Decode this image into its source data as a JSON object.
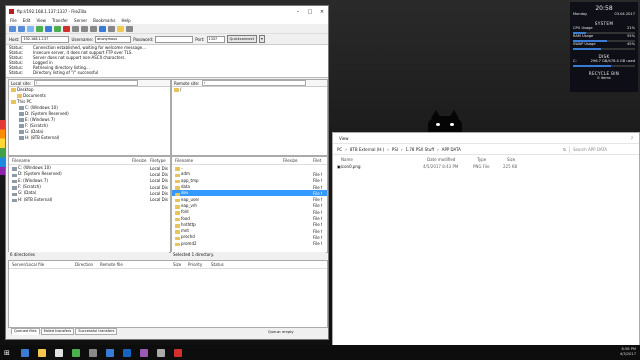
{
  "filezilla": {
    "title": "ftp://192.168.1.137:1337 - FileZilla",
    "menu": [
      "File",
      "Edit",
      "View",
      "Transfer",
      "Server",
      "Bookmarks",
      "Help"
    ],
    "host_label": "Host:",
    "host_value": "192.168.1.137",
    "username_label": "Username:",
    "username_value": "anonymous",
    "password_label": "Password:",
    "password_value": "",
    "port_label": "Port:",
    "port_value": "1337",
    "quickconnect": "Quickconnect",
    "log": [
      {
        "k": "Status:",
        "v": "Connection established, waiting for welcome message..."
      },
      {
        "k": "Status:",
        "v": "Insecure server, it does not support FTP over TLS."
      },
      {
        "k": "Status:",
        "v": "Server does not support non-ASCII characters."
      },
      {
        "k": "Status:",
        "v": "Logged in"
      },
      {
        "k": "Status:",
        "v": "Retrieving directory listing..."
      },
      {
        "k": "Status:",
        "v": "Directory listing of \"/\" successful"
      }
    ],
    "local_site_label": "Local site:",
    "local_site_value": "\\",
    "remote_site_label": "Remote site:",
    "remote_site_value": "/",
    "local_tree": [
      "Desktop",
      "Documents",
      "This PC",
      "C: (Windows 10)",
      "D: (System Reserved)",
      "E: (Windows 7)",
      "F: (Scratch)",
      "G: (Data)",
      "H: (8TB External)"
    ],
    "remote_tree": [
      "/"
    ],
    "local_headers": {
      "name": "Filename",
      "size": "Filesize",
      "type": "Filetype"
    },
    "local_files": [
      {
        "name": "C: (Windows 10)",
        "type": "Local Dis"
      },
      {
        "name": "D: (System Reserved)",
        "type": "Local Dis"
      },
      {
        "name": "E: (Windows 7)",
        "type": "Local Dis"
      },
      {
        "name": "F: (Scratch)",
        "type": "Local Dis"
      },
      {
        "name": "G: (Data)",
        "type": "Local Dis"
      },
      {
        "name": "H: (8TB External)",
        "type": "Local Dis"
      }
    ],
    "remote_headers": {
      "name": "Filename",
      "size": "Filesize",
      "type": "Filet"
    },
    "remote_files": [
      {
        "name": "..",
        "type": ""
      },
      {
        "name": "adm",
        "type": "File f"
      },
      {
        "name": "app_tmp",
        "type": "File f"
      },
      {
        "name": "data",
        "type": "File f"
      },
      {
        "name": "dev",
        "type": "File f"
      },
      {
        "name": "eap_user",
        "type": "File f"
      },
      {
        "name": "eap_vrh",
        "type": "File f"
      },
      {
        "name": "fold",
        "type": "File f"
      },
      {
        "name": "food",
        "type": "File f"
      },
      {
        "name": "hnthttp",
        "type": "File f"
      },
      {
        "name": "mnt",
        "type": "File f"
      },
      {
        "name": "prochd",
        "type": "File f"
      },
      {
        "name": "promd2",
        "type": "File f"
      }
    ],
    "selected_remote_index": 4,
    "local_status": "6 directories",
    "remote_status": "Selected 1 directory.",
    "queue_headers": [
      "Server/Local file",
      "Direction",
      "Remote file",
      "Size",
      "Priority",
      "Status"
    ],
    "queue_tabs": [
      "Queued files",
      "Failed transfers",
      "Successful transfers"
    ],
    "queue_status": "Queue: empty"
  },
  "explorer": {
    "menu": "View",
    "breadcrumbs": [
      "PC",
      "8TB External (H:)",
      "PSI",
      "1.78 PSX Stuff",
      "APP DATA"
    ],
    "search_placeholder": "Search APP DATA",
    "columns": [
      "Name",
      "Date modified",
      "Type",
      "Size"
    ],
    "files": [
      {
        "name": "icon0.png",
        "date": "4/5/2017 8:43 PM",
        "type": "PNG File",
        "size": "225 KB"
      }
    ]
  },
  "rainmeter": {
    "time": "20:58",
    "day": "Monday",
    "date": "03.04.2017",
    "system_label": "SYSTEM",
    "stats": [
      {
        "label": "CPU Usage",
        "value": "21%",
        "level": 0.21
      },
      {
        "label": "RAM Usage",
        "value": "55%",
        "level": 0.55
      },
      {
        "label": "SWAP Usage",
        "value": "45%",
        "level": 0.45
      }
    ],
    "disk_label": "DISK",
    "disk_name": "C:",
    "disk_value": "296.7 GB/476.4 GB used",
    "disk_level": 0.62,
    "recycle_label": "RECYCLE BIN",
    "recycle_value": "0 items"
  },
  "taskbar": {
    "time": "8:58 PM",
    "date": "4/3/2017",
    "icon_colors": [
      "#3a7bd5",
      "#f2c94c",
      "#e0e0e0",
      "#4caf50",
      "#888888",
      "#3a7bd5",
      "#1565c0",
      "#9b59b6",
      "#aaaaaa",
      "#d32f2f"
    ]
  }
}
